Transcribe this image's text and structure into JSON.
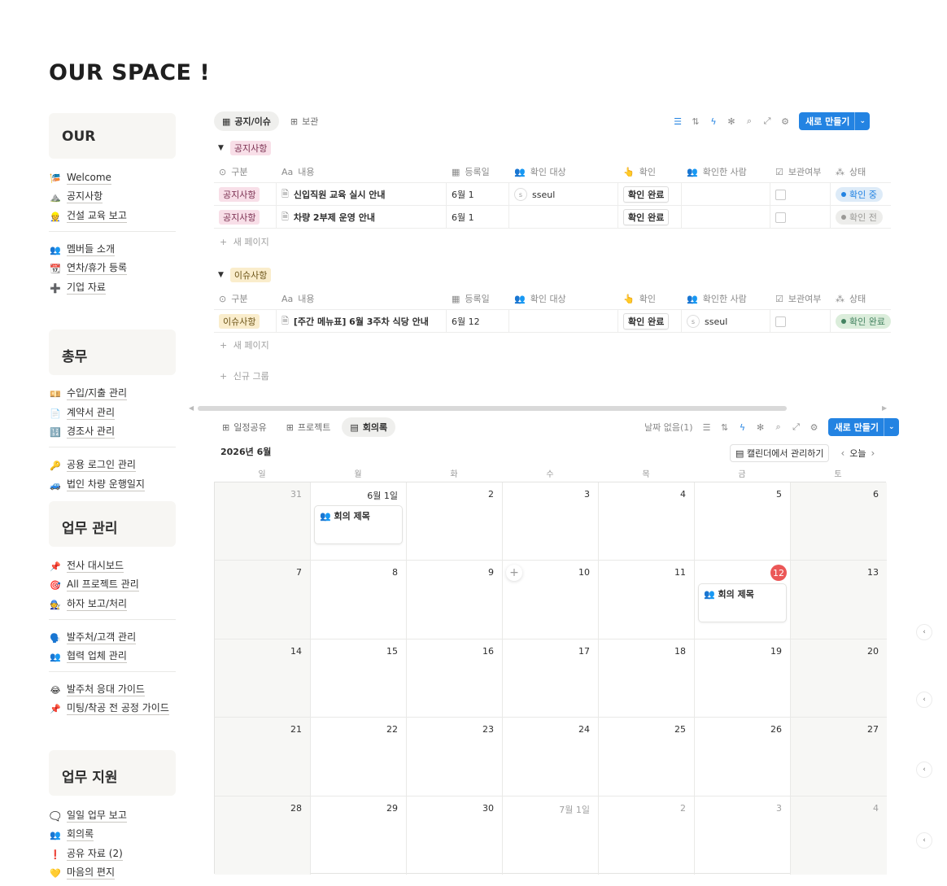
{
  "page": {
    "title": "OUR SPACE !"
  },
  "sidebar": {
    "sections": [
      {
        "title": "OUR",
        "items": [
          {
            "icon": "🎏",
            "label": "Welcome"
          },
          {
            "icon": "⛰️",
            "label": "공지사항"
          },
          {
            "icon": "👷",
            "label": "건설 교육 보고"
          },
          {
            "icon": "👥",
            "label": "멤버들 소개"
          },
          {
            "icon": "📆",
            "label": "연차/휴가 등록"
          },
          {
            "icon": "➕",
            "label": "기업 자료"
          }
        ]
      },
      {
        "title": "총무",
        "items": [
          {
            "icon": "💴",
            "label": "수입/지출 관리"
          },
          {
            "icon": "📄",
            "label": "계약서 관리"
          },
          {
            "icon": "🔢",
            "label": "경조사 관리"
          },
          {
            "icon": "🔑",
            "label": "공용 로그인 관리"
          },
          {
            "icon": "🚙",
            "label": "법인 차량 운행일지"
          }
        ]
      },
      {
        "title": "업무 관리",
        "items": [
          {
            "icon": "📌",
            "label": "전사 대시보드"
          },
          {
            "icon": "🎯",
            "label": "All 프로젝트 관리"
          },
          {
            "icon": "🧑‍🔧",
            "label": "하자 보고/처리"
          },
          {
            "icon": "🗣️",
            "label": "발주처/고객 관리"
          },
          {
            "icon": "👥",
            "label": "협력 업체 관리"
          },
          {
            "icon": "😂",
            "label": "발주처 응대 가이드"
          },
          {
            "icon": "📌",
            "label": "미팅/착공 전 공정 가이드"
          }
        ]
      },
      {
        "title": "업무 지원",
        "items": [
          {
            "icon": "🗨️",
            "label": "일일 업무 보고"
          },
          {
            "icon": "👥",
            "label": "회의록"
          },
          {
            "icon": "❗",
            "label": "공유 자료 (2)"
          },
          {
            "icon": "💛",
            "label": "마음의 편지"
          }
        ]
      }
    ]
  },
  "board1": {
    "tabs": [
      {
        "icon": "▦",
        "label": "공지/이슈"
      },
      {
        "icon": "⊞",
        "label": "보관"
      }
    ],
    "new_button": "새로 만들기",
    "columns": [
      {
        "icon": "⊙",
        "label": "구분"
      },
      {
        "icon": "Aa",
        "label": "내용"
      },
      {
        "icon": "▦",
        "label": "등록일"
      },
      {
        "icon": "👥",
        "label": "확인 대상"
      },
      {
        "icon": "👆",
        "label": "확인"
      },
      {
        "icon": "👥",
        "label": "확인한 사람"
      },
      {
        "icon": "☑",
        "label": "보관여부"
      },
      {
        "icon": "⁂",
        "label": "상태"
      }
    ],
    "groups": [
      {
        "name": "공지사항",
        "color": "pink",
        "rows": [
          {
            "tag": "공지사항",
            "title": "신입직원 교육 실시 안내",
            "date": "6월 1",
            "target": "sseul",
            "confirm": "확인 완료",
            "checker": "",
            "status": "확인 중",
            "status_color": "#2383e2",
            "status_bg": "#ddebf8"
          },
          {
            "tag": "공지사항",
            "title": "차량 2부제 운영 안내",
            "date": "6월 1",
            "target": "",
            "confirm": "확인 완료",
            "checker": "",
            "status": "확인 전",
            "status_color": "#9b9a97",
            "status_bg": "#ededeb"
          }
        ]
      },
      {
        "name": "이슈사항",
        "color": "yellow",
        "rows": [
          {
            "tag": "이슈사항",
            "title": "[주간 메뉴표] 6월 3주차 식당 안내",
            "date": "6월 12",
            "target": "",
            "confirm": "확인 완료",
            "checker": "sseul",
            "status": "확인 완료",
            "status_color": "#448361",
            "status_bg": "#dbeddb"
          }
        ]
      }
    ],
    "add_page": "새 페이지",
    "add_group": "신규 그룹"
  },
  "board2": {
    "tabs": [
      {
        "icon": "⊞",
        "label": "일정공유"
      },
      {
        "icon": "⊞",
        "label": "프로젝트"
      },
      {
        "icon": "▤",
        "label": "회의록"
      }
    ],
    "no_date": "날짜 없음(1)",
    "new_button": "새로 만들기",
    "month": "2026년 6월",
    "manage_btn": "캘린더에서 관리하기",
    "today_btn": "오늘",
    "weekdays": [
      "일",
      "월",
      "화",
      "수",
      "목",
      "금",
      "토"
    ],
    "weeks": [
      [
        {
          "n": "31",
          "dim": true
        },
        {
          "n": "6월 1일"
        },
        {
          "n": "2"
        },
        {
          "n": "3"
        },
        {
          "n": "4"
        },
        {
          "n": "5"
        },
        {
          "n": "6"
        }
      ],
      [
        {
          "n": "7"
        },
        {
          "n": "8"
        },
        {
          "n": "9"
        },
        {
          "n": "10"
        },
        {
          "n": "11"
        },
        {
          "n": "12",
          "today": true
        },
        {
          "n": "13"
        }
      ],
      [
        {
          "n": "14"
        },
        {
          "n": "15"
        },
        {
          "n": "16"
        },
        {
          "n": "17"
        },
        {
          "n": "18"
        },
        {
          "n": "19"
        },
        {
          "n": "20"
        }
      ],
      [
        {
          "n": "21"
        },
        {
          "n": "22"
        },
        {
          "n": "23"
        },
        {
          "n": "24"
        },
        {
          "n": "25"
        },
        {
          "n": "26"
        },
        {
          "n": "27"
        }
      ],
      [
        {
          "n": "28"
        },
        {
          "n": "29"
        },
        {
          "n": "30"
        },
        {
          "n": "7월 1일",
          "dim": true
        },
        {
          "n": "2",
          "dim": true
        },
        {
          "n": "3",
          "dim": true
        },
        {
          "n": "4",
          "dim": true
        }
      ]
    ],
    "events": [
      {
        "week": 0,
        "day": 1,
        "title": "👥 회의 제목"
      },
      {
        "week": 1,
        "day": 5,
        "title": "👥 회의 제목"
      }
    ]
  },
  "colors": {
    "accent": "#2383e2",
    "today": "#eb5757"
  }
}
